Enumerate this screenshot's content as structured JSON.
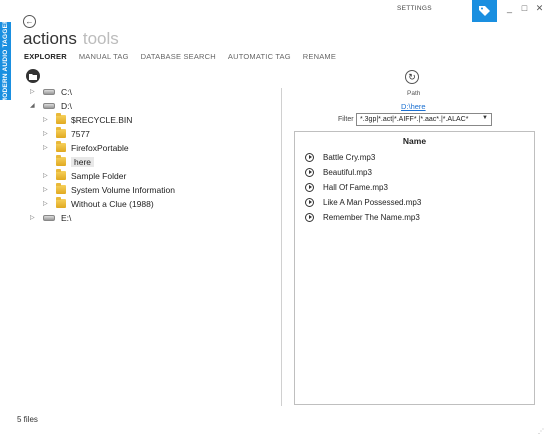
{
  "sidebar_label": "MODERN AUDIO TAGGER",
  "window": {
    "settings": "SETTINGS",
    "minimize": "_",
    "maximize": "□",
    "close": "✕"
  },
  "title": {
    "main": "actions",
    "sub": "tools"
  },
  "tabs": [
    {
      "label": "EXPLORER",
      "active": true
    },
    {
      "label": "MANUAL TAG"
    },
    {
      "label": "DATABASE SEARCH"
    },
    {
      "label": "AUTOMATIC TAG"
    },
    {
      "label": "RENAME"
    }
  ],
  "tree": [
    {
      "label": "C:\\",
      "type": "drive",
      "arrow": "▷"
    },
    {
      "label": "D:\\",
      "type": "drive",
      "arrow": "◢"
    },
    {
      "label": "$RECYCLE.BIN",
      "type": "folder",
      "arrow": "▷"
    },
    {
      "label": "7577",
      "type": "folder",
      "arrow": "▷"
    },
    {
      "label": "FirefoxPortable",
      "type": "folder",
      "arrow": "▷"
    },
    {
      "label": "here",
      "type": "folder",
      "arrow": "",
      "selected": true
    },
    {
      "label": "Sample Folder",
      "type": "folder",
      "arrow": "▷"
    },
    {
      "label": "System Volume Information",
      "type": "folder",
      "arrow": "▷"
    },
    {
      "label": "Without a Clue (1988)",
      "type": "folder",
      "arrow": "▷"
    },
    {
      "label": "E:\\",
      "type": "drive",
      "arrow": "▷"
    }
  ],
  "path": {
    "label": "Path",
    "value": "D:\\here"
  },
  "filter": {
    "label": "Filter",
    "value": "*.3gp|*.act|*.AIFF*.|*.aac*.|*.ALAC*"
  },
  "files": {
    "header": "Name",
    "items": [
      "Battle Cry.mp3",
      "Beautiful.mp3",
      "Hall Of Fame.mp3",
      "Like A Man Possessed.mp3",
      "Remember The Name.mp3"
    ]
  },
  "status": "5 files",
  "colors": {
    "accent": "#1a8fe0",
    "link": "#1a6fd0"
  }
}
